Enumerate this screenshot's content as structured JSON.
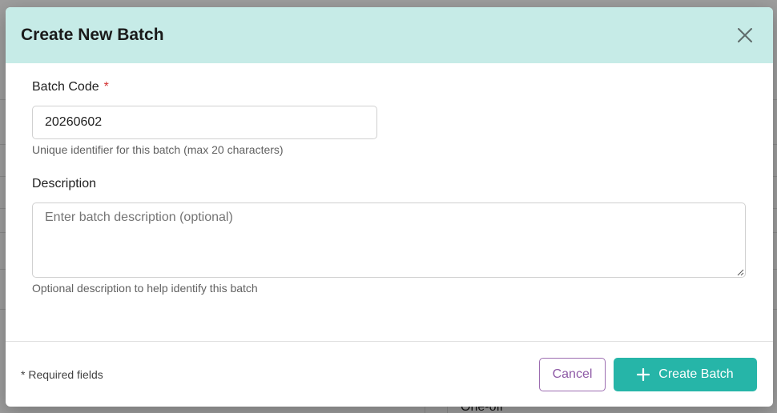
{
  "background": {
    "row_text": "One-off"
  },
  "dialog": {
    "title": "Create New Batch",
    "batch_code": {
      "label": "Batch Code",
      "required_marker": "*",
      "value": "20260602",
      "helper": "Unique identifier for this batch (max 20 characters)"
    },
    "description": {
      "label": "Description",
      "placeholder": "Enter batch description (optional)",
      "value": "",
      "helper": "Optional description to help identify this batch"
    },
    "footer": {
      "note": "* Required fields",
      "cancel_label": "Cancel",
      "create_label": "Create Batch"
    }
  },
  "icons": {
    "close": "close-icon",
    "plus": "plus-icon"
  },
  "colors": {
    "header_bg": "#c6ebe7",
    "primary": "#26b5a8",
    "cancel_accent": "#8e5aa6",
    "required": "#d32f2f"
  }
}
